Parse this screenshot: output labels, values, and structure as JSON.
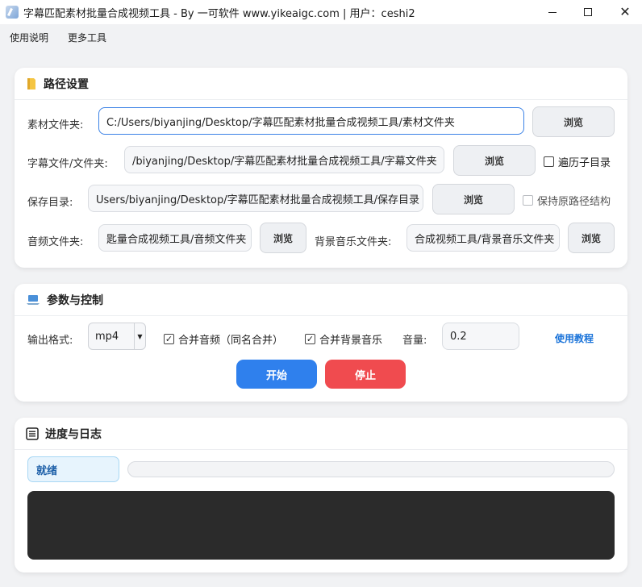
{
  "window": {
    "title": "字幕匹配素材批量合成视频工具 - By 一可软件 www.yikeaigc.com  |  用户：ceshi2"
  },
  "menu": [
    "使用说明",
    "更多工具"
  ],
  "path_section": {
    "title": "路径设置",
    "icon": "folder-icon",
    "material_label": "素材文件夹:",
    "material_value": "C:/Users/biyanjing/Desktop/字幕匹配素材批量合成视频工具/素材文件夹",
    "subtitle_label": "字幕文件/文件夹:",
    "subtitle_value": "/biyanjing/Desktop/字幕匹配素材批量合成视频工具/字幕文件夹",
    "save_label": "保存目录:",
    "save_value": "Users/biyanjing/Desktop/字幕匹配素材批量合成视频工具/保存目录",
    "audio_label": "音频文件夹:",
    "audio_value": "匙量合成视频工具/音频文件夹",
    "bgm_label": "背景音乐文件夹:",
    "bgm_value": "合成视频工具/背景音乐文件夹",
    "browse_label": "浏览",
    "traverse_label": "遍历子目录",
    "traverse_checked": false,
    "keep_structure_label": "保持原路径结构",
    "keep_structure_checked": false
  },
  "control_section": {
    "title": "参数与控制",
    "icon": "laptop-icon",
    "format_label": "输出格式:",
    "format_value": "mp4",
    "merge_audio_label": "合并音频（同名合并）",
    "merge_audio_checked": true,
    "merge_bgm_label": "合并背景音乐",
    "merge_bgm_checked": true,
    "volume_label": "音量:",
    "volume_value": "0.2",
    "tutorial_link": "使用教程",
    "start_label": "开始",
    "stop_label": "停止"
  },
  "progress_section": {
    "title": "进度与日志",
    "icon": "list-icon",
    "status": "就绪",
    "progress": 0,
    "log_text": ""
  },
  "colors": {
    "accent": "#2f80ed",
    "danger": "#f04b4f",
    "link": "#1a73d9",
    "log_bg": "#2b2b2b"
  }
}
